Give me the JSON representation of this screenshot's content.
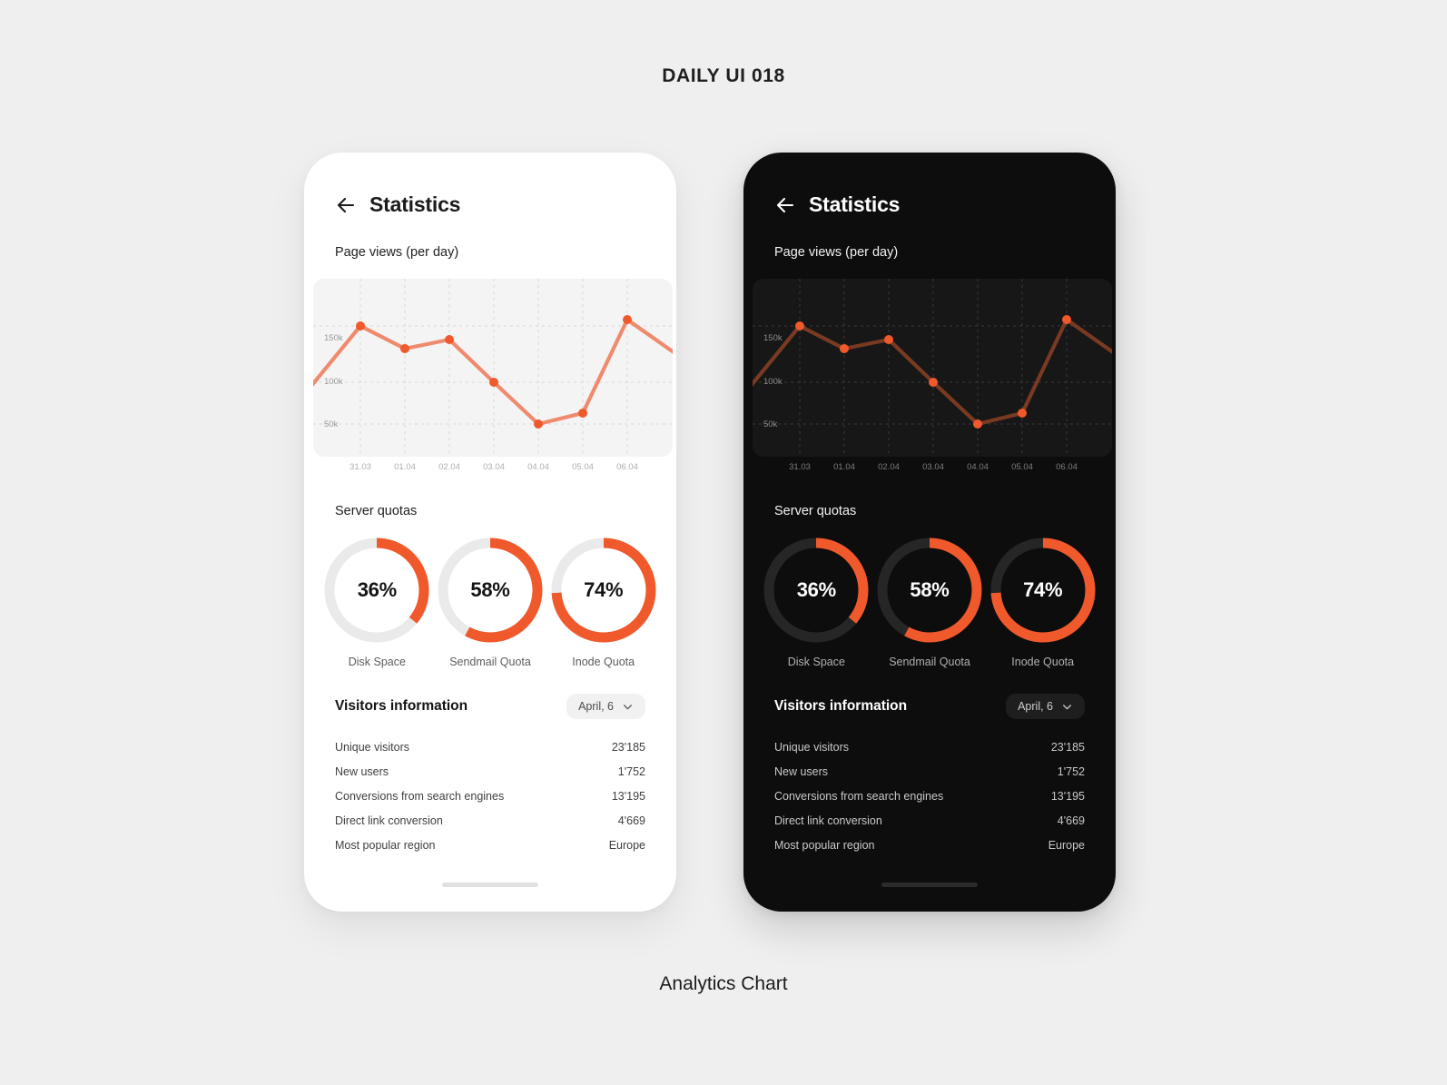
{
  "page": {
    "title": "DAILY UI 018",
    "caption": "Analytics Chart",
    "accent": "#F0592B",
    "line_light": "#F08A6E",
    "line_dark": "#7A3A22",
    "track_light": "#EAEAEA",
    "track_dark": "#262626",
    "bg": "#EFEFEF"
  },
  "screen": {
    "header": {
      "back_icon": "arrow-left-icon",
      "title": "Statistics"
    },
    "chart_section_label": "Page views (per day)",
    "quotas_section_label": "Server quotas",
    "quotas": [
      {
        "label": "Disk Space",
        "value": 36,
        "display": "36%"
      },
      {
        "label": "Sendmail Quota",
        "value": 58,
        "display": "58%"
      },
      {
        "label": "Inode Quota",
        "value": 74,
        "display": "74%"
      }
    ],
    "visitors": {
      "title": "Visitors information",
      "date_filter": {
        "label": "April, 6",
        "icon": "chevron-down-icon"
      },
      "rows": [
        {
          "key": "Unique visitors",
          "value": "23'185"
        },
        {
          "key": "New users",
          "value": "1'752"
        },
        {
          "key": "Conversions from search engines",
          "value": "13'195"
        },
        {
          "key": "Direct link conversion",
          "value": "4'669"
        },
        {
          "key": "Most popular region",
          "value": "Europe"
        }
      ]
    }
  },
  "chart_data": {
    "type": "line",
    "title": "Page views (per day)",
    "xlabel": "",
    "ylabel": "",
    "x": [
      "31.03",
      "01.04",
      "02.04",
      "03.04",
      "04.04",
      "05.04",
      "06.04"
    ],
    "categories": [
      "31.03",
      "01.04",
      "02.04",
      "03.04",
      "04.04",
      "05.04",
      "06.04"
    ],
    "values": [
      160000,
      135000,
      143000,
      100000,
      40000,
      57000,
      168000
    ],
    "series": [
      {
        "name": "Page views",
        "values": [
          160000,
          135000,
          143000,
          100000,
          40000,
          57000,
          168000
        ]
      }
    ],
    "yticks": [
      50000,
      100000,
      150000
    ],
    "ytick_labels": [
      "50k",
      "100k",
      "150k"
    ],
    "ylim": [
      0,
      200000
    ],
    "grid": true,
    "legend": false,
    "notes": "Line continues off-screen on both sides; left edge enters near 95k, right edge exits near 132k"
  },
  "themes": [
    {
      "name": "light"
    },
    {
      "name": "dark"
    }
  ]
}
